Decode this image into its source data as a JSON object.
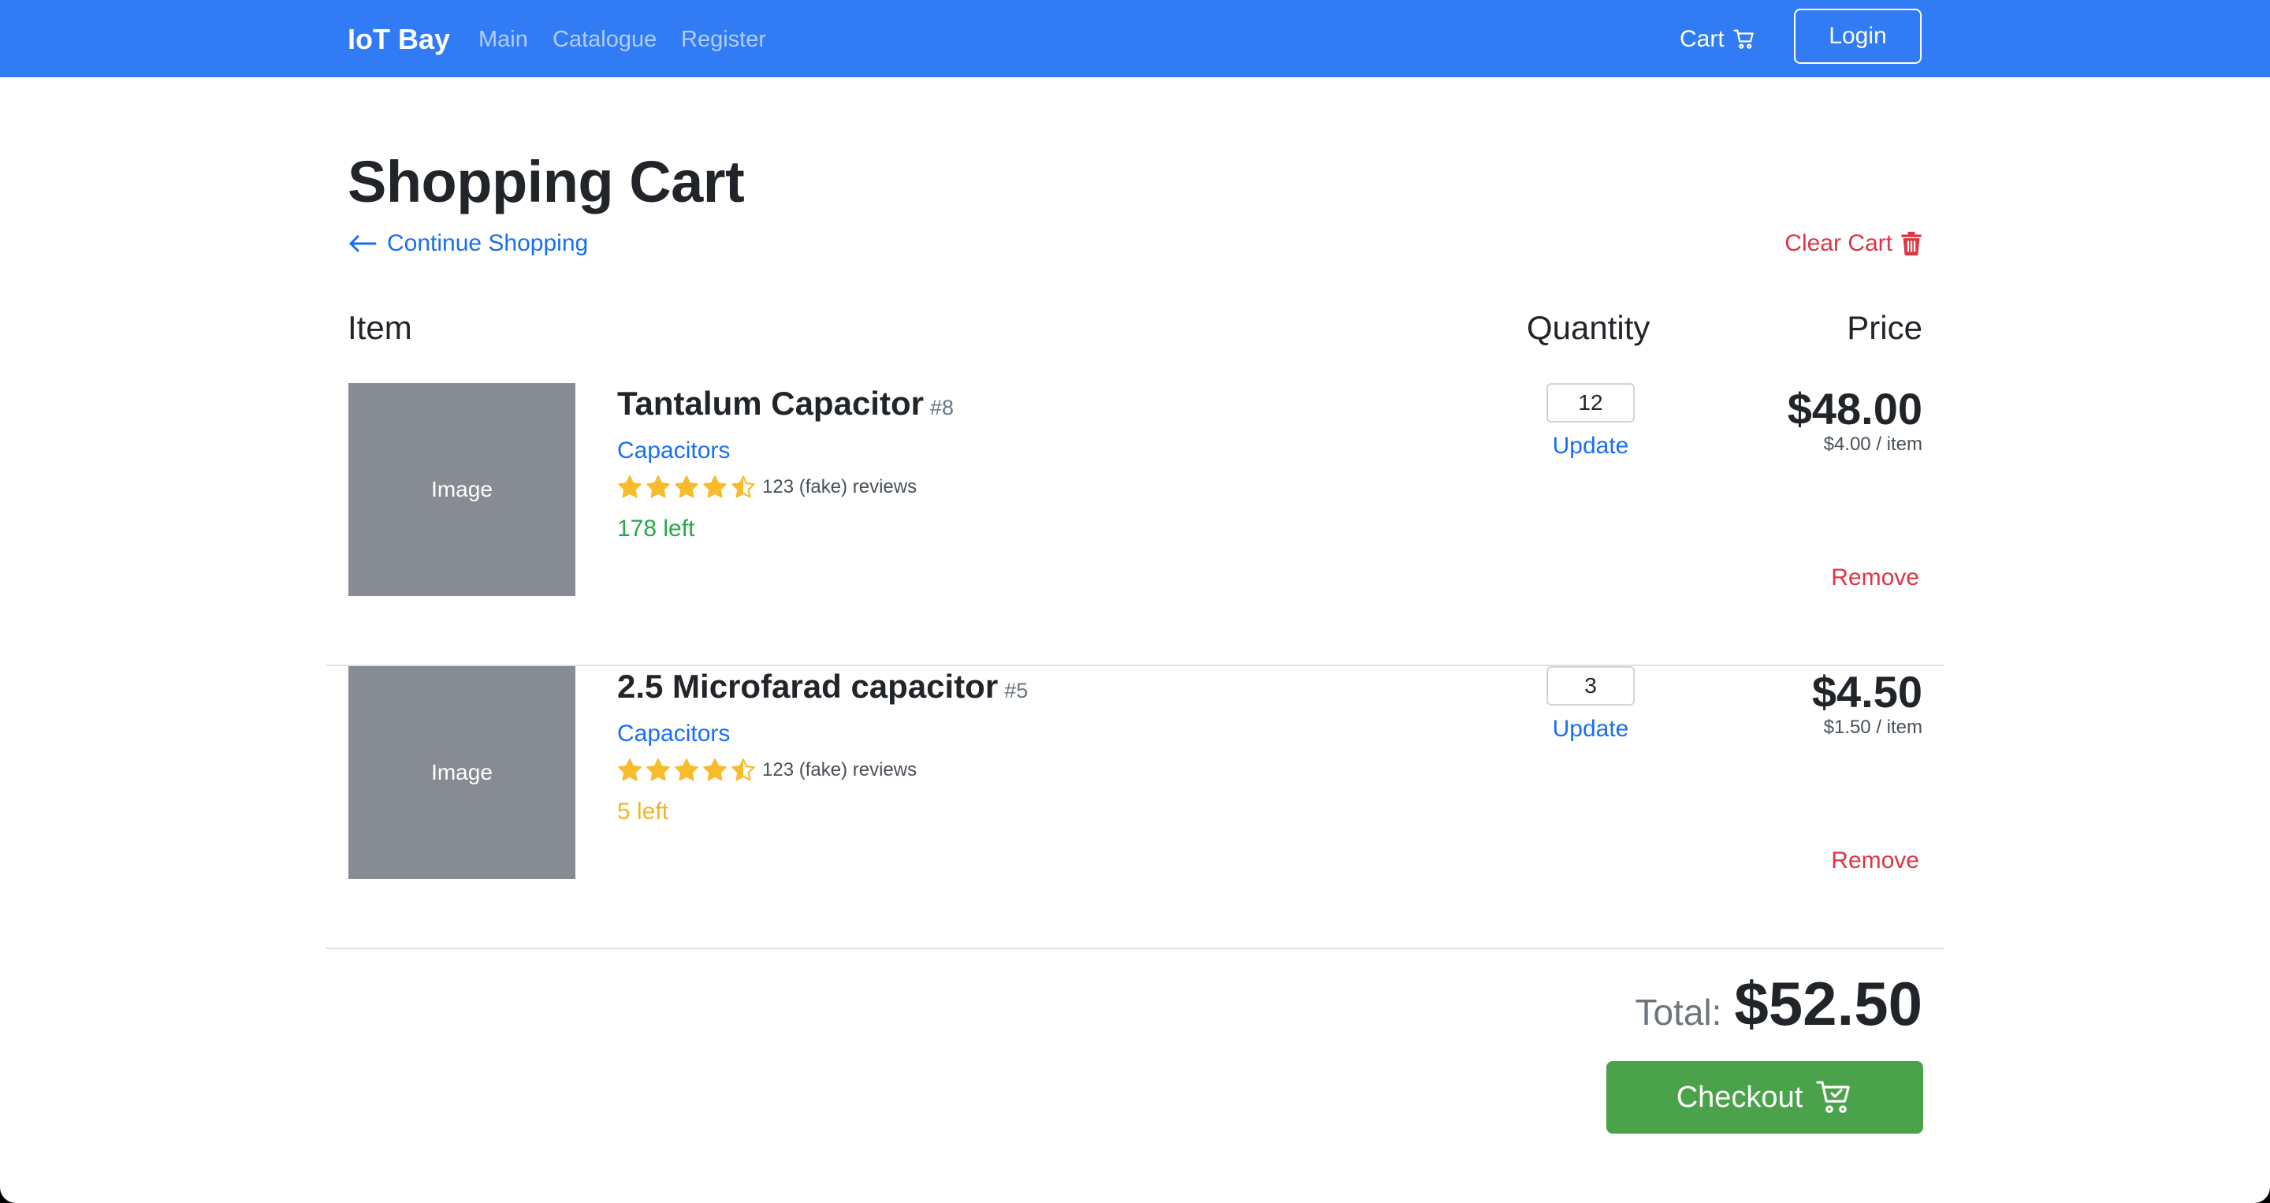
{
  "navbar": {
    "brand": "IoT Bay",
    "links": [
      "Main",
      "Catalogue",
      "Register"
    ],
    "cart_label": "Cart",
    "login_label": "Login"
  },
  "page": {
    "title": "Shopping Cart",
    "continue_label": "Continue Shopping",
    "clear_label": "Clear Cart"
  },
  "table": {
    "headers": {
      "item": "Item",
      "quantity": "Quantity",
      "price": "Price"
    }
  },
  "items": [
    {
      "image_label": "Image",
      "name": "Tantalum Capacitor",
      "id": "#8",
      "category": "Capacitors",
      "rating": 4.5,
      "reviews": "123 (fake) reviews",
      "stock": "178 left",
      "stock_color": "#28a745",
      "quantity": "12",
      "update_label": "Update",
      "line_price": "$48.00",
      "unit_price": "$4.00 / item",
      "remove_label": "Remove"
    },
    {
      "image_label": "Image",
      "name": "2.5 Microfarad capacitor",
      "id": "#5",
      "category": "Capacitors",
      "rating": 4.5,
      "reviews": "123 (fake) reviews",
      "stock": "5 left",
      "stock_color": "#f0b429",
      "quantity": "3",
      "update_label": "Update",
      "line_price": "$4.50",
      "unit_price": "$1.50 / item",
      "remove_label": "Remove"
    }
  ],
  "summary": {
    "total_label": "Total:",
    "total_value": "$52.50",
    "checkout_label": "Checkout"
  },
  "colors": {
    "navbar": "#317bf5",
    "link": "#1a6ff0",
    "danger": "#dc3545",
    "star": "#f7bb2c",
    "checkout": "#4aa24a"
  },
  "icons": {
    "cart": "cart-icon",
    "back": "arrow-left-icon",
    "trash": "trash-icon",
    "star": "star-icon",
    "checkout": "cart-check-icon"
  }
}
